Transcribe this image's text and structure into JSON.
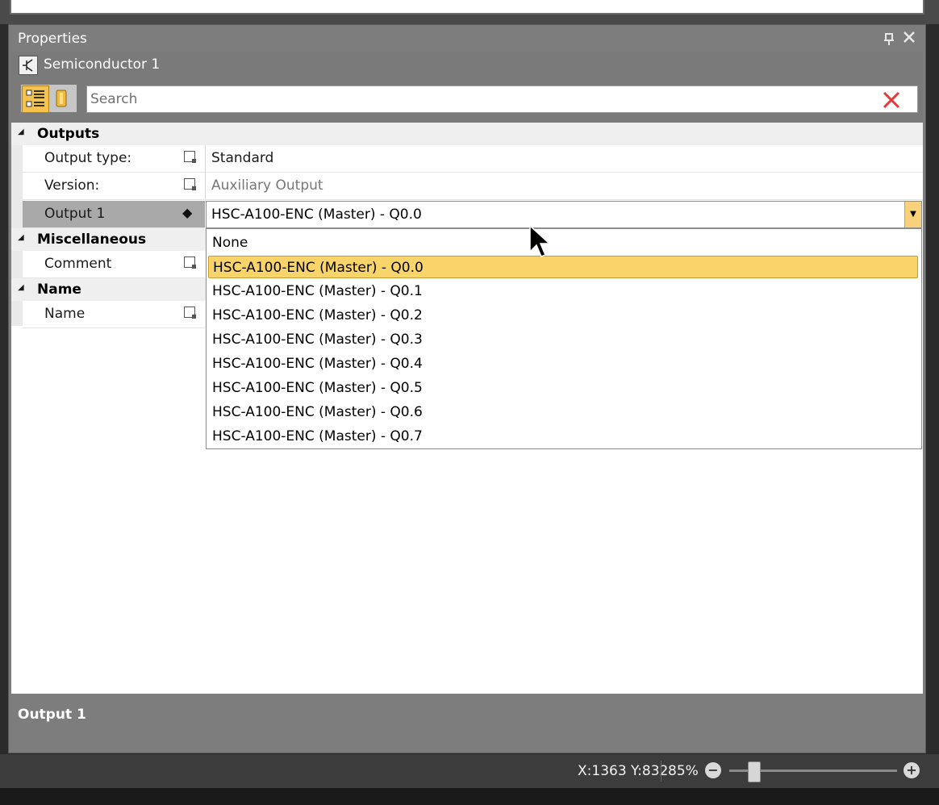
{
  "panel": {
    "title": "Properties",
    "pin_icon": "pin-icon",
    "close_icon": "close-icon"
  },
  "object": {
    "name": "Semiconductor 1",
    "icon": "semiconductor-icon"
  },
  "toolbar": {
    "categorized_icon": "categorized-view-icon",
    "alphabetical_icon": "alphabetical-view-icon",
    "search_placeholder": "Search",
    "search_value": "",
    "clear_icon": "clear-search-icon"
  },
  "grid": {
    "categories": [
      {
        "label": "Outputs",
        "properties": [
          {
            "name": "Output type:",
            "value": "Standard"
          },
          {
            "name": "Version:",
            "value": "Auxiliary Output"
          },
          {
            "name": "Output 1",
            "value": "HSC-A100-ENC (Master) - Q0.0"
          }
        ]
      },
      {
        "label": "Miscellaneous",
        "properties": [
          {
            "name": "Comment",
            "value": ""
          }
        ]
      },
      {
        "label": "Name",
        "properties": [
          {
            "name": "Name",
            "value": ""
          }
        ]
      }
    ]
  },
  "dropdown": {
    "selected_index": 1,
    "options": [
      "None",
      "HSC-A100-ENC (Master) - Q0.0",
      "HSC-A100-ENC (Master) - Q0.1",
      "HSC-A100-ENC (Master) - Q0.2",
      "HSC-A100-ENC (Master) - Q0.3",
      "HSC-A100-ENC (Master) - Q0.4",
      "HSC-A100-ENC (Master) - Q0.5",
      "HSC-A100-ENC (Master) - Q0.6",
      "HSC-A100-ENC (Master) - Q0.7"
    ]
  },
  "description": {
    "title": "Output 1"
  },
  "status": {
    "coordinates": "X:1363 Y:832",
    "zoom": "85%",
    "zoom_level_fraction": 0.15
  },
  "colors": {
    "selection": "#f9d46a",
    "panel_bg": "#7d7d7d",
    "clear_red": "#e23a3a"
  }
}
